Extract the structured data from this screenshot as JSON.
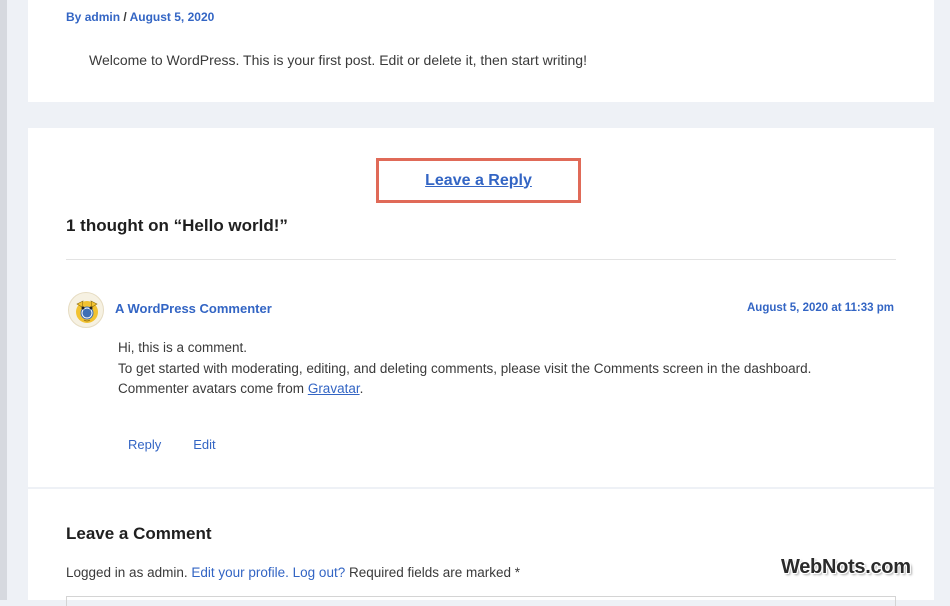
{
  "post": {
    "meta_author_prefix": "By ",
    "author": "admin",
    "meta_separator": " / ",
    "date": "August 5, 2020",
    "content": "Welcome to WordPress. This is your first post. Edit or delete it, then start writing!"
  },
  "comments": {
    "leave_reply_label": "Leave a Reply",
    "title": "1 thought on “Hello world!”",
    "items": [
      {
        "author": "A WordPress Commenter",
        "date": "August 5, 2020 at 11:33 pm",
        "line1": "Hi, this is a comment.",
        "line2": "To get started with moderating, editing, and deleting comments, please visit the Comments screen in the dashboard.",
        "line3_prefix": "Commenter avatars come from ",
        "line3_link": "Gravatar",
        "line3_suffix": ".",
        "reply_label": "Reply",
        "edit_label": "Edit"
      }
    ]
  },
  "comment_form": {
    "title": "Leave a Comment",
    "logged_in_prefix": "Logged in as admin. ",
    "edit_profile_label": "Edit your profile.",
    "logout_label": "Log out?",
    "required_note": " Required fields are marked *"
  },
  "watermark": "WebNots.com",
  "colors": {
    "link": "#3365c4",
    "highlight_border": "#e06a58",
    "page_bg": "#eef1f6"
  }
}
